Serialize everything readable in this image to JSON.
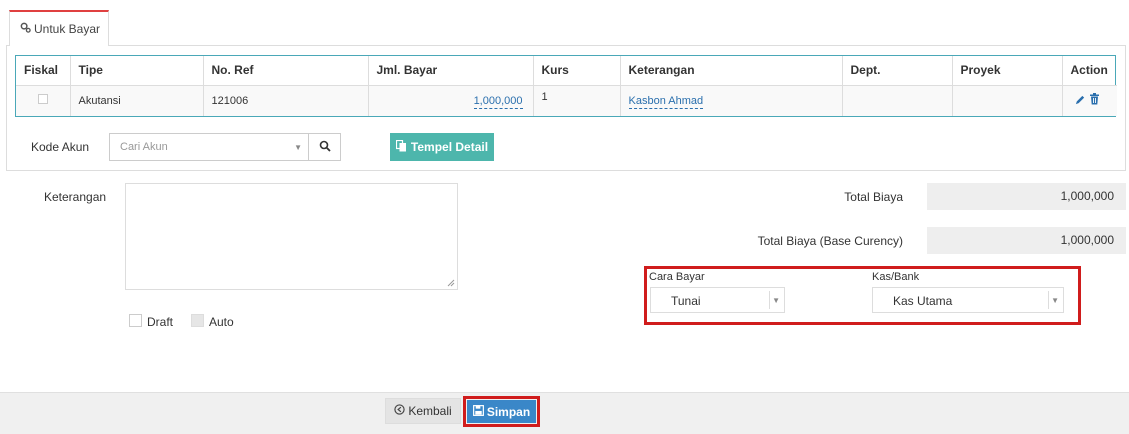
{
  "tab": {
    "label": "Untuk Bayar",
    "icon": "gears-icon"
  },
  "table": {
    "headers": [
      "Fiskal",
      "Tipe",
      "No. Ref",
      "Jml. Bayar",
      "Kurs",
      "Keterangan",
      "Dept.",
      "Proyek",
      "Action"
    ],
    "row": {
      "tipe": "Akutansi",
      "no_ref": "121006",
      "jml_bayar": "1,000,000",
      "kurs": "1",
      "keterangan": "Kasbon Ahmad",
      "dept": "",
      "proyek": ""
    }
  },
  "kode_akun": {
    "label": "Kode Akun",
    "placeholder": "Cari Akun"
  },
  "tempel_detail": {
    "label": "Tempel Detail"
  },
  "keterangan": {
    "label": "Keterangan"
  },
  "draft": {
    "label": "Draft"
  },
  "auto": {
    "label": "Auto"
  },
  "total_biaya": {
    "label": "Total Biaya",
    "value": "1,000,000"
  },
  "total_biaya_base": {
    "label": "Total Biaya (Base Curency)",
    "value": "1,000,000"
  },
  "cara_bayar": {
    "label": "Cara Bayar",
    "value": "Tunai"
  },
  "kas_bank": {
    "label": "Kas/Bank",
    "value": "Kas Utama"
  },
  "footer": {
    "kembali": "Kembali",
    "simpan": "Simpan"
  },
  "colors": {
    "accent": "#4db6ac",
    "primary": "#3a87c8",
    "highlight": "#d01c1c",
    "link": "#2a6fad"
  }
}
